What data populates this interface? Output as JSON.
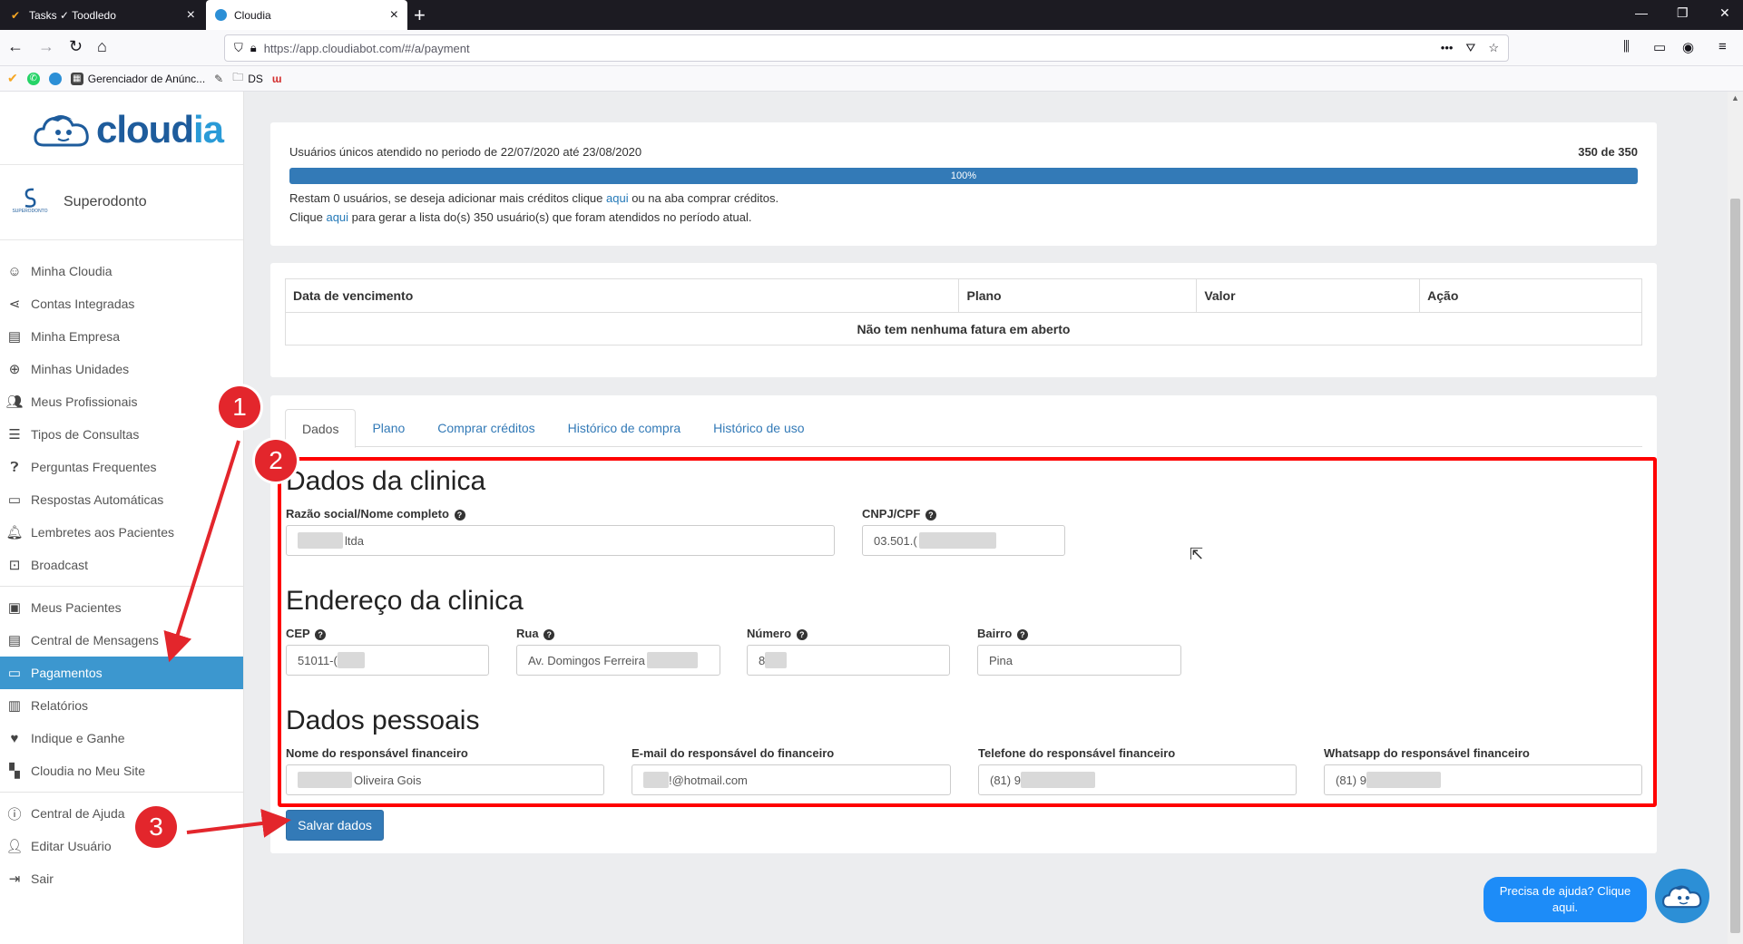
{
  "browser": {
    "tabs": [
      {
        "title": "Tasks ✓ Toodledo",
        "active": false
      },
      {
        "title": "Cloudia",
        "active": true
      }
    ],
    "url": "https://app.cloudiabot.com/#/a/payment",
    "bookmarks": [
      "Gerenciador de Anúnc...",
      "DS"
    ]
  },
  "sidebar": {
    "logo_text_main": "cloud",
    "logo_text_accent": "ia",
    "business_name": "Superodonto",
    "business_logo_caption": "SUPERODONTO",
    "menu_group1": [
      {
        "label": "Minha Cloudia",
        "icon": "smiley-icon"
      },
      {
        "label": "Contas Integradas",
        "icon": "share-icon"
      },
      {
        "label": "Minha Empresa",
        "icon": "store-icon"
      },
      {
        "label": "Minhas Unidades",
        "icon": "plus-circle-icon"
      },
      {
        "label": "Meus Profissionais",
        "icon": "people-icon"
      },
      {
        "label": "Tipos de Consultas",
        "icon": "list-icon"
      },
      {
        "label": "Perguntas Frequentes",
        "icon": "question-icon"
      },
      {
        "label": "Respostas Automáticas",
        "icon": "chat-icon"
      },
      {
        "label": "Lembretes aos Pacientes",
        "icon": "bell-icon"
      },
      {
        "label": "Broadcast",
        "icon": "broadcast-icon"
      }
    ],
    "menu_group2": [
      {
        "label": "Meus Pacientes",
        "icon": "contact-icon"
      },
      {
        "label": "Central de Mensagens",
        "icon": "message-icon"
      },
      {
        "label": "Pagamentos",
        "icon": "payment-icon",
        "active": true
      },
      {
        "label": "Relatórios",
        "icon": "chart-icon"
      },
      {
        "label": "Indique e Ganhe",
        "icon": "heart-icon"
      },
      {
        "label": "Cloudia no Meu Site",
        "icon": "widgets-icon"
      }
    ],
    "menu_group3": [
      {
        "label": "Central de Ajuda",
        "icon": "help-icon"
      },
      {
        "label": "Editar Usuário",
        "icon": "user-icon"
      },
      {
        "label": "Sair",
        "icon": "logout-icon"
      }
    ]
  },
  "usage": {
    "period_text": "Usuários únicos atendido no periodo de 22/07/2020 até 23/08/2020",
    "count": "350 de 350",
    "progress_label": "100%",
    "progress_percent": 100,
    "remaining_prefix": "Restam 0 usuários, se deseja adicionar mais créditos clique ",
    "remaining_link": "aqui",
    "remaining_suffix": " ou na aba comprar créditos.",
    "list_prefix": "Clique ",
    "list_link": "aqui",
    "list_suffix": " para gerar a lista do(s) 350 usuário(s) que foram atendidos no período atual."
  },
  "invoices": {
    "headers": [
      "Data de vencimento",
      "Plano",
      "Valor",
      "Ação"
    ],
    "empty_message": "Não tem nenhuma fatura em aberto"
  },
  "tabs": [
    "Dados",
    "Plano",
    "Comprar créditos",
    "Histórico de compra",
    "Histórico de uso"
  ],
  "form": {
    "section_clinic": "Dados da clinica",
    "razao_label": "Razão social/Nome completo",
    "razao_value": "ltda",
    "cnpj_label": "CNPJ/CPF",
    "cnpj_value": "03.501.(",
    "section_address": "Endereço da clinica",
    "cep_label": "CEP",
    "cep_value": "51011-(",
    "rua_label": "Rua",
    "rua_value": "Av. Domingos Ferreira",
    "numero_label": "Número",
    "numero_value": "8",
    "bairro_label": "Bairro",
    "bairro_value": "Pina",
    "section_personal": "Dados pessoais",
    "nome_label": "Nome do responsável financeiro",
    "nome_value": "Oliveira Gois",
    "email_label": "E-mail do responsável do financeiro",
    "email_value": "!@hotmail.com",
    "tel_label": "Telefone do responsável financeiro",
    "tel_value": "(81) 9",
    "whats_label": "Whatsapp do responsável financeiro",
    "whats_value": "(81) 9",
    "save_label": "Salvar dados"
  },
  "annotations": {
    "badge1": "1",
    "badge2": "2",
    "badge3": "3",
    "highlight_color": "#ff0000"
  },
  "help_widget": {
    "text": "Precisa de ajuda? Clique aqui."
  },
  "colors": {
    "primary": "#337ab7",
    "sidebar_active": "#3c97cf",
    "help_bubble": "#1d8cf8"
  }
}
